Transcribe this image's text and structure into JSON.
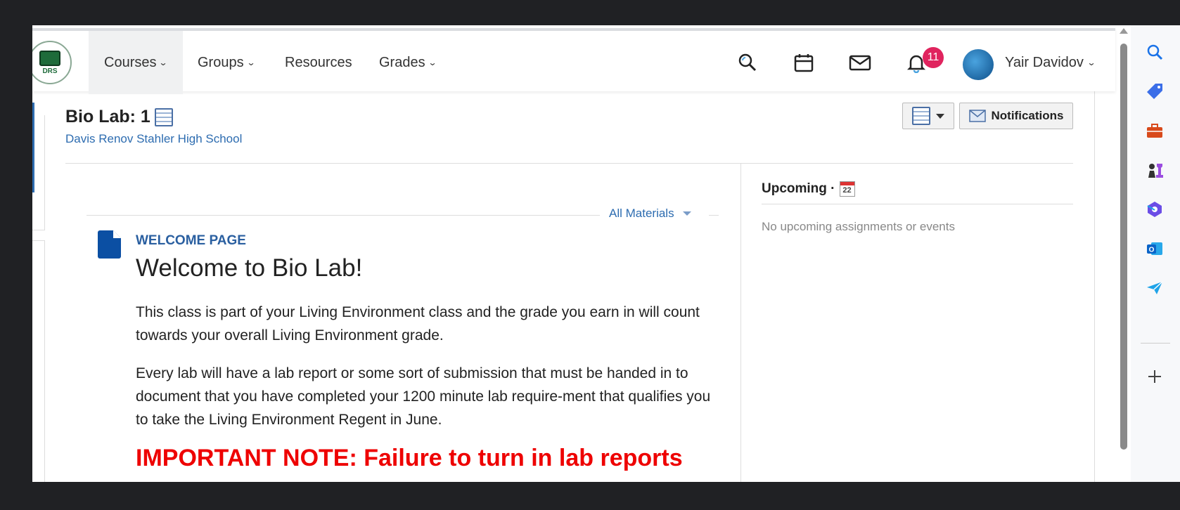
{
  "nav": {
    "items": [
      {
        "label": "Courses",
        "has_menu": true,
        "active": true
      },
      {
        "label": "Groups",
        "has_menu": true,
        "active": false
      },
      {
        "label": "Resources",
        "has_menu": false,
        "active": false
      },
      {
        "label": "Grades",
        "has_menu": true,
        "active": false
      }
    ],
    "logo_text": "DRS",
    "notification_count": "11",
    "user_name": "Yair Davidov",
    "chevron": "⌄",
    "icons": [
      "search-icon",
      "calendar-icon",
      "mail-icon",
      "bell-icon"
    ]
  },
  "course": {
    "title": "Bio Lab: 1",
    "school": "Davis Renov Stahler High School",
    "notifications_label": "Notifications"
  },
  "materials": {
    "filter_label": "All Materials",
    "page_type": "WELCOME PAGE",
    "heading": "Welcome to Bio Lab!",
    "paragraph1": "This class is part of your Living Environment class and the grade you earn in will count towards your overall Living Environment grade.",
    "paragraph2": "Every lab will have a lab report or some sort of submission that must be handed in to document that you have completed your 1200 minute lab require-ment that qualifies you to take the Living Environment Regent in June.",
    "important": "IMPORTANT NOTE:  Failure to turn in lab reports"
  },
  "upcoming": {
    "title": "Upcoming ·",
    "calendar_day": "22",
    "empty_text": "No upcoming assignments or events"
  },
  "side_panel": {
    "icons": [
      "search-icon",
      "tag-icon",
      "briefcase-icon",
      "chess-icon",
      "copilot-icon",
      "outlook-icon",
      "send-icon",
      "add-icon"
    ]
  },
  "colors": {
    "accent": "#2d6cb0",
    "badge": "#e0245e",
    "important": "#ee0000",
    "frame": "#202124"
  }
}
